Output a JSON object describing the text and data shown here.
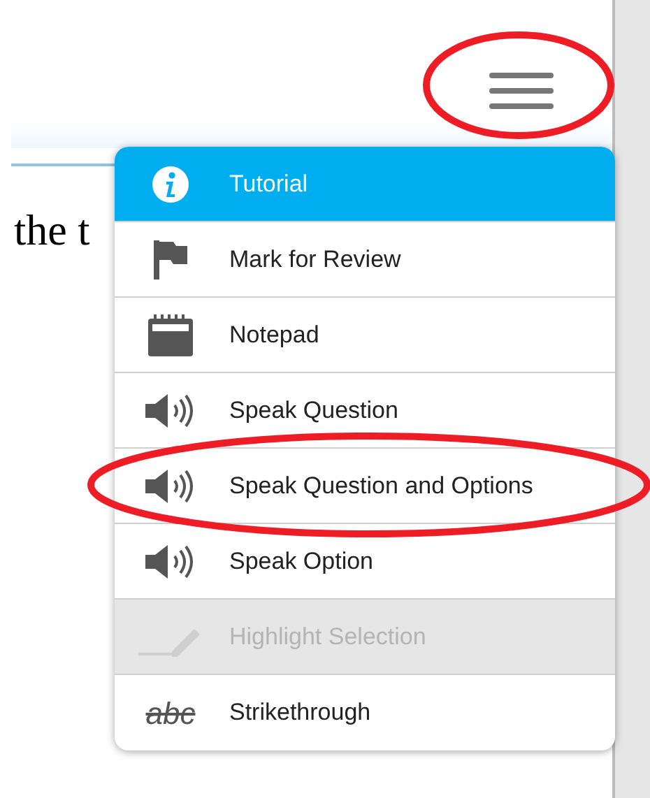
{
  "passage": {
    "text": "the t"
  },
  "menu": {
    "items": [
      {
        "label": "Tutorial",
        "kind": "info",
        "selected": true,
        "disabled": false,
        "annotated": false
      },
      {
        "label": "Mark for Review",
        "kind": "flag",
        "selected": false,
        "disabled": false,
        "annotated": false
      },
      {
        "label": "Notepad",
        "kind": "notepad",
        "selected": false,
        "disabled": false,
        "annotated": false
      },
      {
        "label": "Speak Question",
        "kind": "speaker",
        "selected": false,
        "disabled": false,
        "annotated": false
      },
      {
        "label": "Speak Question and Options",
        "kind": "speaker",
        "selected": false,
        "disabled": false,
        "annotated": true
      },
      {
        "label": "Speak Option",
        "kind": "speaker",
        "selected": false,
        "disabled": false,
        "annotated": false
      },
      {
        "label": "Highlight Selection",
        "kind": "pencil",
        "selected": false,
        "disabled": true,
        "annotated": false
      },
      {
        "label": "Strikethrough",
        "kind": "strike",
        "glyph": "abc",
        "selected": false,
        "disabled": false,
        "annotated": false
      }
    ]
  },
  "menu_button": {
    "annotated": true
  }
}
